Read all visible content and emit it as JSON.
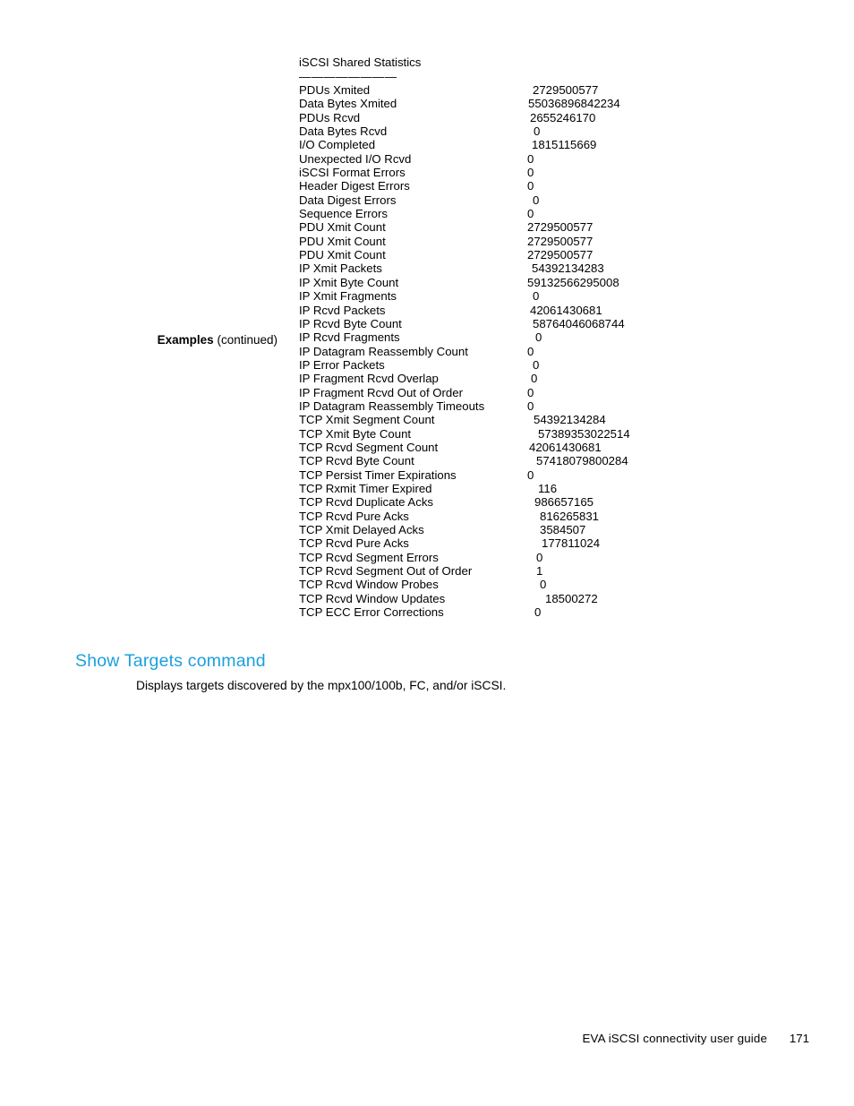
{
  "document": {
    "footer_title": "EVA iSCSI connectivity user guide",
    "page_number": "171"
  },
  "margin_label": {
    "strong": "Examples",
    "rest": " (continued)"
  },
  "listing": {
    "title": "iSCSI Shared Statistics",
    "rule": "————————",
    "rows": [
      {
        "key": "PDUs Xmited",
        "value": "2729500577",
        "value_x": 595
      },
      {
        "key": "Data Bytes Xmited",
        "value": "55036896842234",
        "value_x": 590
      },
      {
        "key": "PDUs Rcvd",
        "value": "2655246170",
        "value_x": 592
      },
      {
        "key": "Data Bytes Rcvd",
        "value": "0",
        "value_x": 596
      },
      {
        "key": "I/O Completed",
        "value": "1815115669",
        "value_x": 594
      },
      {
        "key": "Unexpected I/O Rcvd",
        "value": "0",
        "value_x": 589
      },
      {
        "key": "iSCSI Format Errors",
        "value": "0",
        "value_x": 589
      },
      {
        "key": "Header Digest Errors",
        "value": "0",
        "value_x": 589
      },
      {
        "key": "Data Digest Errors",
        "value": "0",
        "value_x": 595
      },
      {
        "key": "Sequence Errors",
        "value": "0",
        "value_x": 589
      },
      {
        "key": "PDU Xmit Count",
        "value": "2729500577",
        "value_x": 589
      },
      {
        "key": "PDU Xmit Count",
        "value": "2729500577",
        "value_x": 589
      },
      {
        "key": "PDU Xmit Count",
        "value": "2729500577",
        "value_x": 589
      },
      {
        "key": "IP Xmit Packets",
        "value": "54392134283",
        "value_x": 594
      },
      {
        "key": "IP Xmit Byte Count",
        "value": "59132566295008",
        "value_x": 589
      },
      {
        "key": "IP Xmit Fragments",
        "value": "0",
        "value_x": 595
      },
      {
        "key": "IP Rcvd Packets",
        "value": "42061430681",
        "value_x": 592
      },
      {
        "key": "IP Rcvd Byte Count",
        "value": "58764046068744",
        "value_x": 595
      },
      {
        "key": "IP Rcvd Fragments",
        "value": "0",
        "value_x": 598
      },
      {
        "key": "IP Datagram Reassembly Count",
        "value": "0",
        "value_x": 589
      },
      {
        "key": "IP Error Packets",
        "value": "0",
        "value_x": 595
      },
      {
        "key": "IP Fragment Rcvd Overlap",
        "value": "0",
        "value_x": 593
      },
      {
        "key": "IP Fragment Rcvd Out of Order",
        "value": "0",
        "value_x": 589
      },
      {
        "key": "IP Datagram Reassembly Timeouts",
        "value": "0",
        "value_x": 589
      },
      {
        "key": "TCP Xmit Segment Count",
        "value": "54392134284",
        "value_x": 596
      },
      {
        "key": "TCP Xmit Byte Count",
        "value": "57389353022514",
        "value_x": 601
      },
      {
        "key": "TCP Rcvd Segment Count",
        "value": "42061430681",
        "value_x": 591
      },
      {
        "key": "TCP Rcvd Byte Count",
        "value": "57418079800284",
        "value_x": 599
      },
      {
        "key": "TCP Persist Timer Expirations",
        "value": "0",
        "value_x": 589
      },
      {
        "key": "TCP Rxmit Timer Expired",
        "value": "116",
        "value_x": 601
      },
      {
        "key": "TCP Rcvd Duplicate Acks",
        "value": "986657165",
        "value_x": 597
      },
      {
        "key": "TCP Rcvd Pure Acks",
        "value": "816265831",
        "value_x": 603
      },
      {
        "key": "TCP Xmit Delayed Acks",
        "value": "3584507",
        "value_x": 603
      },
      {
        "key": "TCP Rcvd Pure Acks",
        "value": "177811024",
        "value_x": 605
      },
      {
        "key": "TCP Rcvd Segment Errors",
        "value": "0",
        "value_x": 599
      },
      {
        "key": "TCP Rcvd Segment Out of Order",
        "value": "1",
        "value_x": 599
      },
      {
        "key": "TCP Rcvd Window Probes",
        "value": "0",
        "value_x": 603
      },
      {
        "key": "TCP Rcvd Window Updates",
        "value": "18500272",
        "value_x": 609
      },
      {
        "key": "TCP ECC Error Corrections",
        "value": "0",
        "value_x": 597
      }
    ]
  },
  "section": {
    "heading": "Show Targets command",
    "paragraph": "Displays targets discovered by the mpx100/100b, FC, and/or iSCSI."
  },
  "colors": {
    "heading_blue": "#1CA0DC",
    "body_text": "#000000",
    "page_background": "#FFFFFF"
  }
}
